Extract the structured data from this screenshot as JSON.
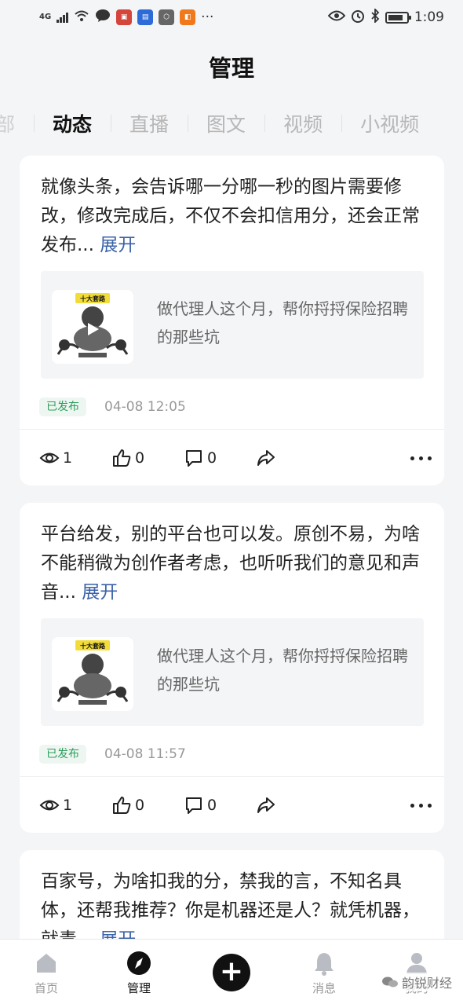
{
  "status_bar": {
    "network": "4G",
    "time": "1:09",
    "app_icons": [
      {
        "name": "wechat-bubble-icon",
        "color": "#333333"
      },
      {
        "name": "news-app-icon",
        "color": "#d4453b"
      },
      {
        "name": "blue-app-icon",
        "color": "#2d6bd8"
      },
      {
        "name": "gray-app-icon",
        "color": "#666666"
      },
      {
        "name": "orange-app-icon",
        "color": "#f07a1b"
      }
    ],
    "more": "···"
  },
  "header": {
    "title": "管理"
  },
  "tabs": [
    {
      "label": "部",
      "active": false
    },
    {
      "label": "动态",
      "active": true
    },
    {
      "label": "直播",
      "active": false
    },
    {
      "label": "图文",
      "active": false
    },
    {
      "label": "视频",
      "active": false
    },
    {
      "label": "小视频",
      "active": false
    }
  ],
  "posts": [
    {
      "text": "就像头条，会告诉哪一分哪一秒的图片需要修改，修改完成后，不仅不会扣信用分，还会正常发布...",
      "expand": "展开",
      "article_title": "做代理人这个月，帮你捋捋保险招聘的那些坑",
      "thumb_caption": "十大套路",
      "status": "已发布",
      "time": "04-08 12:05",
      "views": "1",
      "likes": "0",
      "comments": "0"
    },
    {
      "text": "平台给发，别的平台也可以发。原创不易，为啥不能稍微为创作者考虑，也听听我们的意见和声音...",
      "expand": "展开",
      "article_title": "做代理人这个月，帮你捋捋保险招聘的那些坑",
      "thumb_caption": "十大套路",
      "status": "已发布",
      "time": "04-08 11:57",
      "views": "1",
      "likes": "0",
      "comments": "0"
    },
    {
      "text": "百家号，为啥扣我的分，禁我的言，不知名具体，还帮我推荐？你是机器还是人？就凭机器，就毒...",
      "expand": "展开"
    }
  ],
  "bottom_nav": [
    {
      "label": "首页",
      "icon": "home-icon",
      "active": false
    },
    {
      "label": "管理",
      "icon": "compass-icon",
      "active": true
    },
    {
      "label": "",
      "icon": "plus-icon",
      "active": false
    },
    {
      "label": "消息",
      "icon": "bell-icon",
      "active": false
    },
    {
      "label": "我的",
      "icon": "user-icon",
      "active": false
    }
  ],
  "watermark": "韵锐财经",
  "colors": {
    "accent_link": "#3a62a8",
    "status_green": "#2e9d5d",
    "background": "#f4f5f7"
  }
}
